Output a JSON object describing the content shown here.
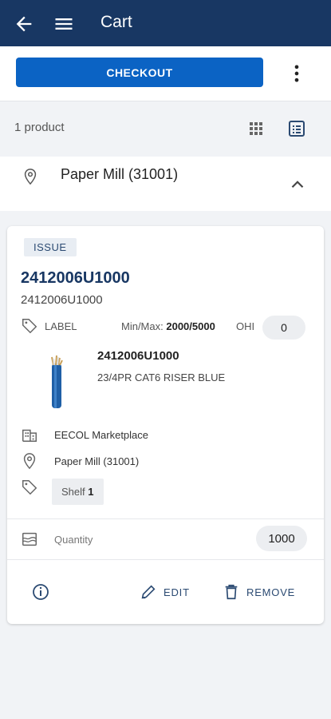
{
  "header": {
    "title": "Cart"
  },
  "toolbar": {
    "checkout_label": "CHECKOUT"
  },
  "summary": {
    "count": "1 product"
  },
  "location": {
    "name": "Paper Mill (31001)"
  },
  "item": {
    "badge": "ISSUE",
    "part_number": "2412006U1000",
    "part_number_secondary": "2412006U1000",
    "label_text": "LABEL",
    "minmax_label": "Min/Max:",
    "minmax_value": "2000/5000",
    "ohi_label": "OHI",
    "ohi_value": "0",
    "product_title": "2412006U1000",
    "product_description": "23/4PR CAT6 RISER BLUE",
    "supplier": "EECOL Marketplace",
    "location": "Paper Mill (31001)",
    "shelf_label": "Shelf",
    "shelf_value": "1",
    "quantity_label": "Quantity",
    "quantity_value": "1000",
    "edit_label": "EDIT",
    "remove_label": "REMOVE"
  },
  "colors": {
    "appbar": "#183763",
    "primary_button": "#0b63c4",
    "accent_text": "#2b4a72"
  },
  "icons": [
    "back-arrow-icon",
    "hamburger-menu-icon",
    "more-vert-icon",
    "grid-view-icon",
    "list-view-icon",
    "location-pin-icon",
    "chevron-up-icon",
    "tag-icon",
    "building-icon",
    "quantity-icon",
    "info-icon",
    "pencil-icon",
    "trash-icon"
  ]
}
